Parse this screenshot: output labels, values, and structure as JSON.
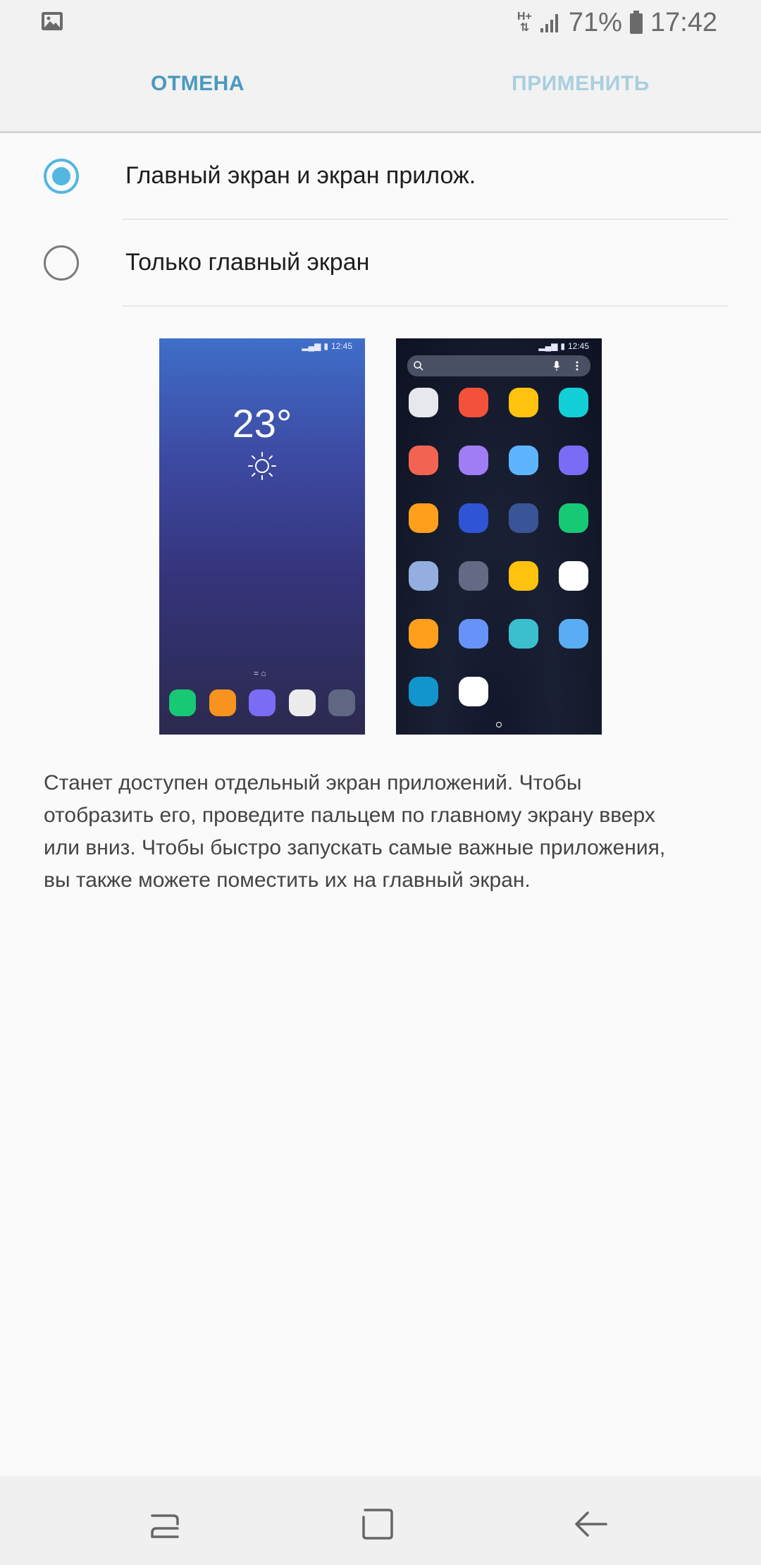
{
  "status_bar": {
    "left_icon": "gallery-icon",
    "network_type": "H+",
    "battery": "71%",
    "time": "17:42"
  },
  "header": {
    "cancel_label": "ОТМЕНА",
    "apply_label": "ПРИМЕНИТЬ"
  },
  "options": [
    {
      "label": "Главный экран и экран прилож.",
      "selected": true
    },
    {
      "label": "Только главный экран",
      "selected": false
    }
  ],
  "preview": {
    "home_time": "12:45",
    "apps_time": "12:45",
    "temperature": "23°",
    "dock_colors": [
      "#17c874",
      "#f7931e",
      "#7a6cf5",
      "#ececec",
      "#5f6783"
    ],
    "grid_colors": [
      "#e6e8ee",
      "#f4513a",
      "#ffc20e",
      "#13cfd8",
      "#f26451",
      "#a07df5",
      "#5db5ff",
      "#7a6cf5",
      "#ff9f1c",
      "#2f55d4",
      "#3a5597",
      "#17c874",
      "#94aee0",
      "#626a85",
      "#ffc20e",
      "#ffffff",
      "#ff9f1c",
      "#6793f8",
      "#3bbfcf",
      "#5aadf2",
      "#1294cc",
      "#ffffff"
    ]
  },
  "description": "Станет доступен отдельный экран приложений. Чтобы отобразить его, проведите пальцем по главному экрану вверх или вниз. Чтобы быстро запускать самые важные приложения, вы также можете поместить их на главный экран.",
  "nav": {
    "recent": "recent-apps-icon",
    "home": "home-icon",
    "back": "back-icon"
  },
  "colors": {
    "accent": "#53b7e0",
    "cancel": "#4a99bf",
    "apply_disabled": "#a9cfe0"
  }
}
